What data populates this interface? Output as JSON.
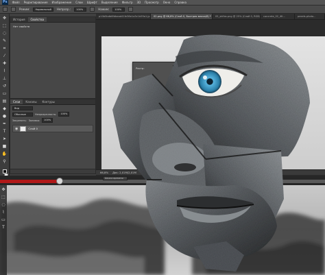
{
  "app": {
    "logo": "Ps"
  },
  "menu": [
    "Файл",
    "Редактирование",
    "Изображение",
    "Слои",
    "Шрифт",
    "Выделение",
    "Фильтр",
    "3D",
    "Просмотр",
    "Окно",
    "Справка"
  ],
  "options": {
    "fill_label": "Режим:",
    "fill_value": "Нормальный",
    "opacity_label": "Непрозр.:",
    "opacity_value": "100%",
    "flow_label": "Нажим:",
    "flow_value": "100%"
  },
  "history_panel": {
    "tabs": [
      "История",
      "Свойства"
    ],
    "active_tab": 1,
    "content": "Нет свойств"
  },
  "layers_panel": {
    "tabs": [
      "Слои",
      "Каналы",
      "Контуры"
    ],
    "kind_label": "Вид",
    "blend_mode": "Обычные",
    "opacity_label": "Непрозрачность:",
    "opacity_value": "100%",
    "lock_label": "Закрепить:",
    "fill_label": "Заливка:",
    "fill_value": "100%",
    "layer_name": "Слой 0"
  },
  "doc_tabs": [
    "p10b5bdb6fdbead41fe36e1a3c1b59a1.jpg @ 66,7% (RGB/8...",
    "02.png @ 66,8% (Слой 0, Быстрая маска/8) *",
    "05_skifos.png @ 25% (Слой 0, RGB/...",
    "concrete_02_4K...",
    "pexels-photo..."
  ],
  "doc_tabs_active": 1,
  "dialog": {
    "label": "Растр:",
    "value": "80,0"
  },
  "status": {
    "zoom": "66,8%",
    "info": "Док: 2,01M/2,01M"
  },
  "strip": {
    "button_label": "Шкала времени"
  },
  "colors": {
    "accent_red": "#b01818",
    "iris": "#3a9ac8",
    "ui_dark": "#3a3a3a"
  },
  "icons": [
    "move-icon",
    "marquee-icon",
    "lasso-icon",
    "quick-select-icon",
    "crop-icon",
    "eyedropper-icon",
    "healing-icon",
    "brush-icon",
    "stamp-icon",
    "history-brush-icon",
    "eraser-icon",
    "gradient-icon",
    "blur-icon",
    "dodge-icon",
    "pen-icon",
    "type-icon",
    "path-select-icon",
    "shape-icon",
    "hand-icon",
    "zoom-icon"
  ]
}
